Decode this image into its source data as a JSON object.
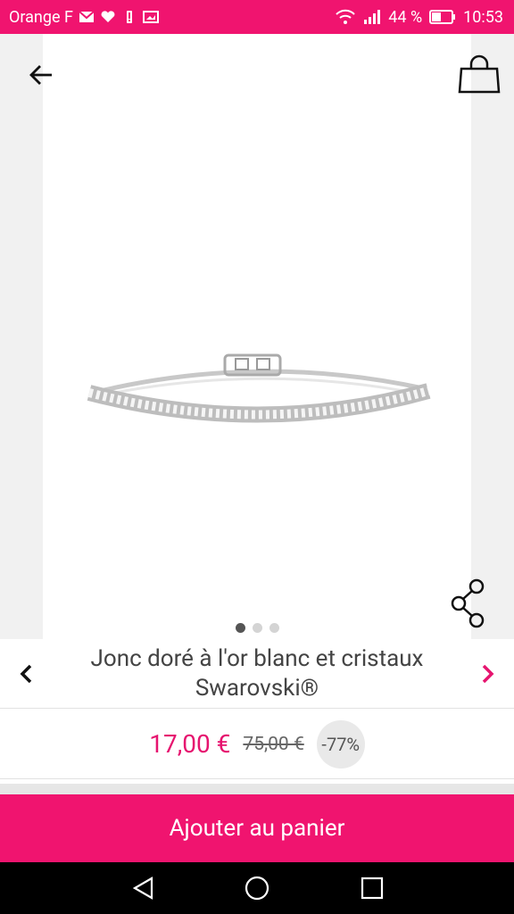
{
  "status_bar": {
    "carrier": "Orange F",
    "battery": "44 %",
    "time": "10:53"
  },
  "app_bar": {
    "back_icon": "arrow-back-icon",
    "cart_icon": "shopping-bag-icon"
  },
  "gallery": {
    "image_alt": "bangle-bracelet-image",
    "dots": [
      {
        "active": true
      },
      {
        "active": false
      },
      {
        "active": false
      }
    ],
    "share_icon": "share-icon"
  },
  "product": {
    "title": "Jonc doré à l'or blanc et cristaux Swarovski®",
    "price": "17,00 €",
    "old_price": "75,00 €",
    "discount": "-77%"
  },
  "cta": {
    "label": "Ajouter au panier"
  },
  "colors": {
    "accent": "#f0146f",
    "price": "#e6146f"
  }
}
